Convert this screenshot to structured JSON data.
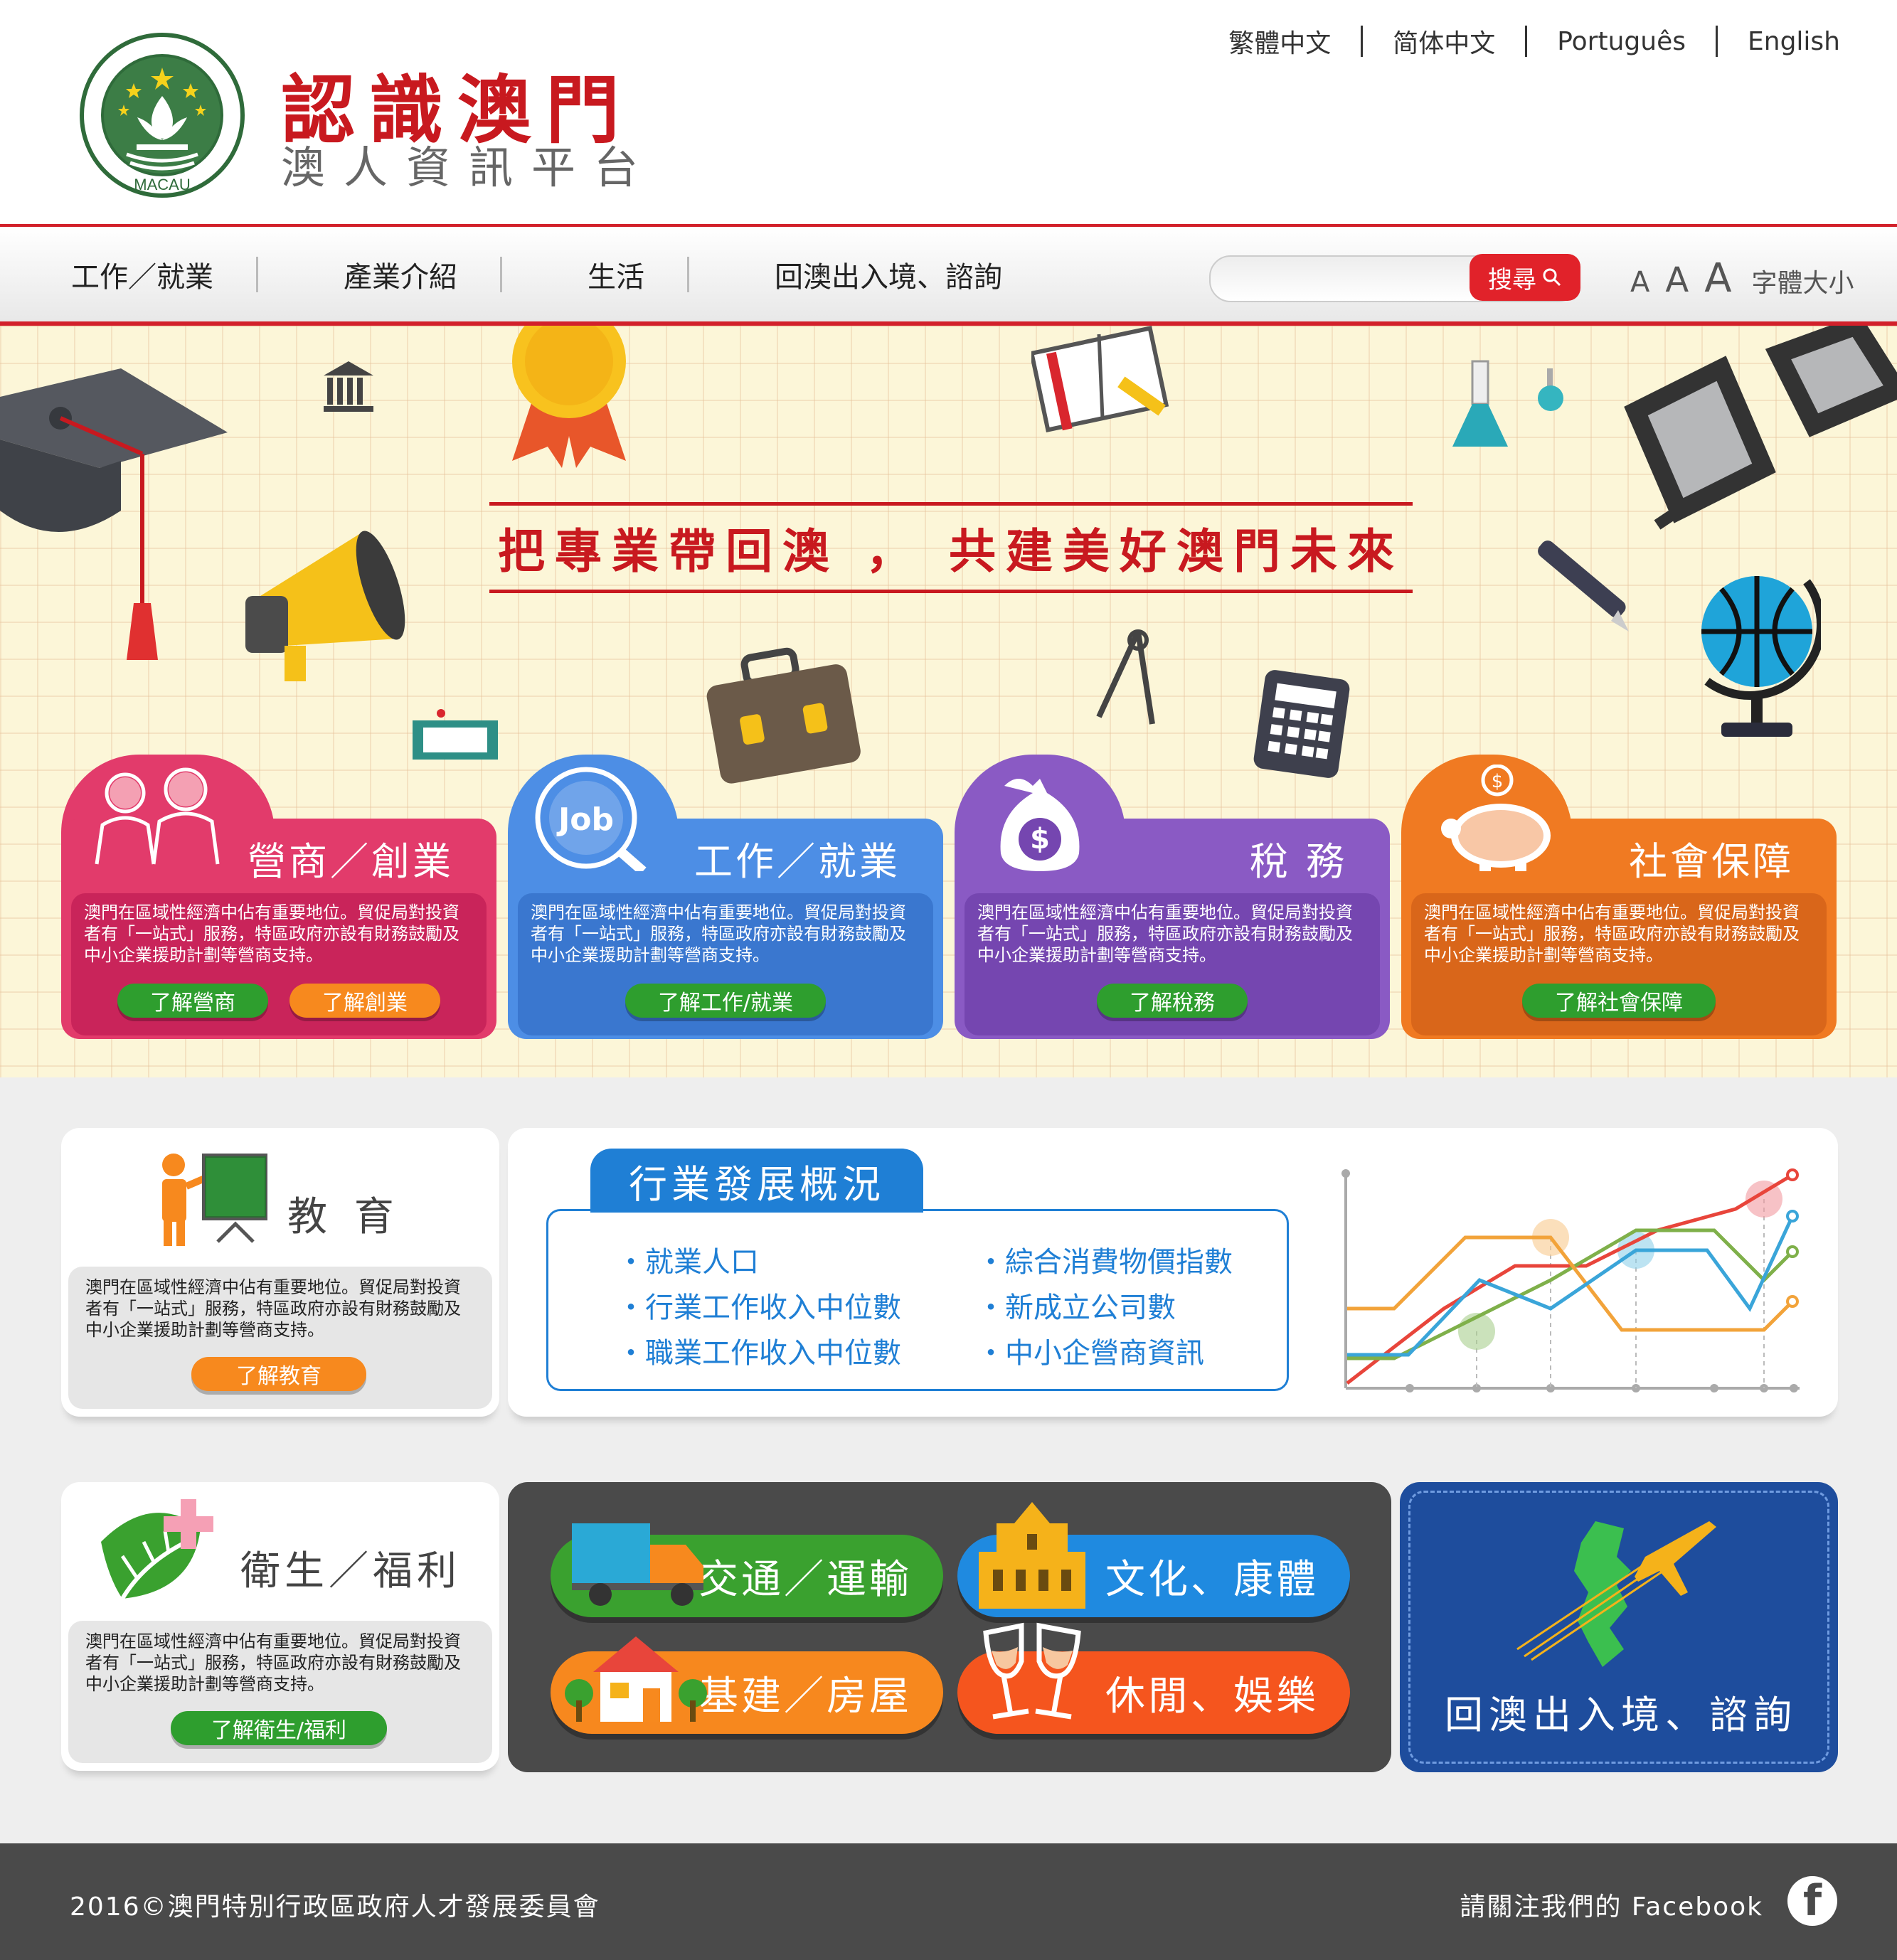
{
  "header": {
    "site_title": "認識澳門",
    "site_subtitle": "澳人資訊平台",
    "logo_text": "MACAU",
    "languages": [
      "繁體中文",
      "简体中文",
      "Português",
      "English"
    ]
  },
  "nav": {
    "items": [
      "工作／就業",
      "產業介紹",
      "生活",
      "回澳出入境、諮詢"
    ],
    "search_label": "搜尋",
    "search_placeholder": "",
    "font_sizes": [
      "A",
      "A",
      "A"
    ],
    "font_size_label": "字體大小"
  },
  "hero": {
    "slogan": "把專業帶回澳 ， 共建美好澳門未來",
    "cards": [
      {
        "title": "營商／創業",
        "color": "#e23b6b",
        "dark": "#c9245a",
        "desc": "澳門在區域性經濟中佔有重要地位。貿促局對投資者有「一站式」服務，特區政府亦設有財務鼓勵及中小企業援助計劃等營商支持。",
        "buttons": [
          "了解營商",
          "了解創業"
        ],
        "icon": "businesspeople-icon"
      },
      {
        "title": "工作／就業",
        "color": "#4d8ee5",
        "dark": "#3a77cf",
        "desc": "澳門在區域性經濟中佔有重要地位。貿促局對投資者有「一站式」服務，特區政府亦設有財務鼓勵及中小企業援助計劃等營商支持。",
        "buttons": [
          "了解工作/就業"
        ],
        "icon": "job-search-icon"
      },
      {
        "title": "稅 務",
        "color": "#8a5ac4",
        "dark": "#7546b0",
        "desc": "澳門在區域性經濟中佔有重要地位。貿促局對投資者有「一站式」服務，特區政府亦設有財務鼓勵及中小企業援助計劃等營商支持。",
        "buttons": [
          "了解稅務"
        ],
        "icon": "money-bag-icon"
      },
      {
        "title": "社會保障",
        "color": "#f07a22",
        "dark": "#d9661a",
        "desc": "澳門在區域性經濟中佔有重要地位。貿促局對投資者有「一站式」服務，特區政府亦設有財務鼓勵及中小企業援助計劃等營商支持。",
        "buttons": [
          "了解社會保障"
        ],
        "icon": "piggy-bank-icon"
      }
    ]
  },
  "education": {
    "title": "教 育",
    "desc": "澳門在區域性經濟中佔有重要地位。貿促局對投資者有「一站式」服務，特區政府亦設有財務鼓勵及中小企業援助計劃等營商支持。",
    "button": "了解教育"
  },
  "stats": {
    "title": "行業發展概況",
    "left": [
      "就業人口",
      "行業工作收入中位數",
      "職業工作收入中位數"
    ],
    "right": [
      "綜合消費物價指數",
      "新成立公司數",
      "中小企營商資訊"
    ]
  },
  "health": {
    "title": "衛生／福利",
    "desc": "澳門在區域性經濟中佔有重要地位。貿促局對投資者有「一站式」服務，特區政府亦設有財務鼓勵及中小企業援助計劃等營商支持。",
    "button": "了解衛生/福利"
  },
  "categories": [
    {
      "label": "交通／運輸",
      "color": "#3aa12f",
      "icon": "truck-icon"
    },
    {
      "label": "文化、康體",
      "color": "#1f8ae0",
      "icon": "church-ruins-icon"
    },
    {
      "label": "基建／房屋",
      "color": "#f7881e",
      "icon": "house-icon"
    },
    {
      "label": "休閒、娛樂",
      "color": "#f5551e",
      "icon": "wine-glasses-icon"
    }
  ],
  "return_panel": {
    "label": "回澳出入境、諮詢"
  },
  "footer": {
    "copyright": "2016©澳門特別行政區政府人才發展委員會",
    "facebook_text": "請關注我們的 Facebook",
    "facebook_icon": "f"
  },
  "colors": {
    "brand_red": "#c8191f",
    "stats_blue": "#1f7fd5",
    "footer_gray": "#4a4a4a"
  }
}
